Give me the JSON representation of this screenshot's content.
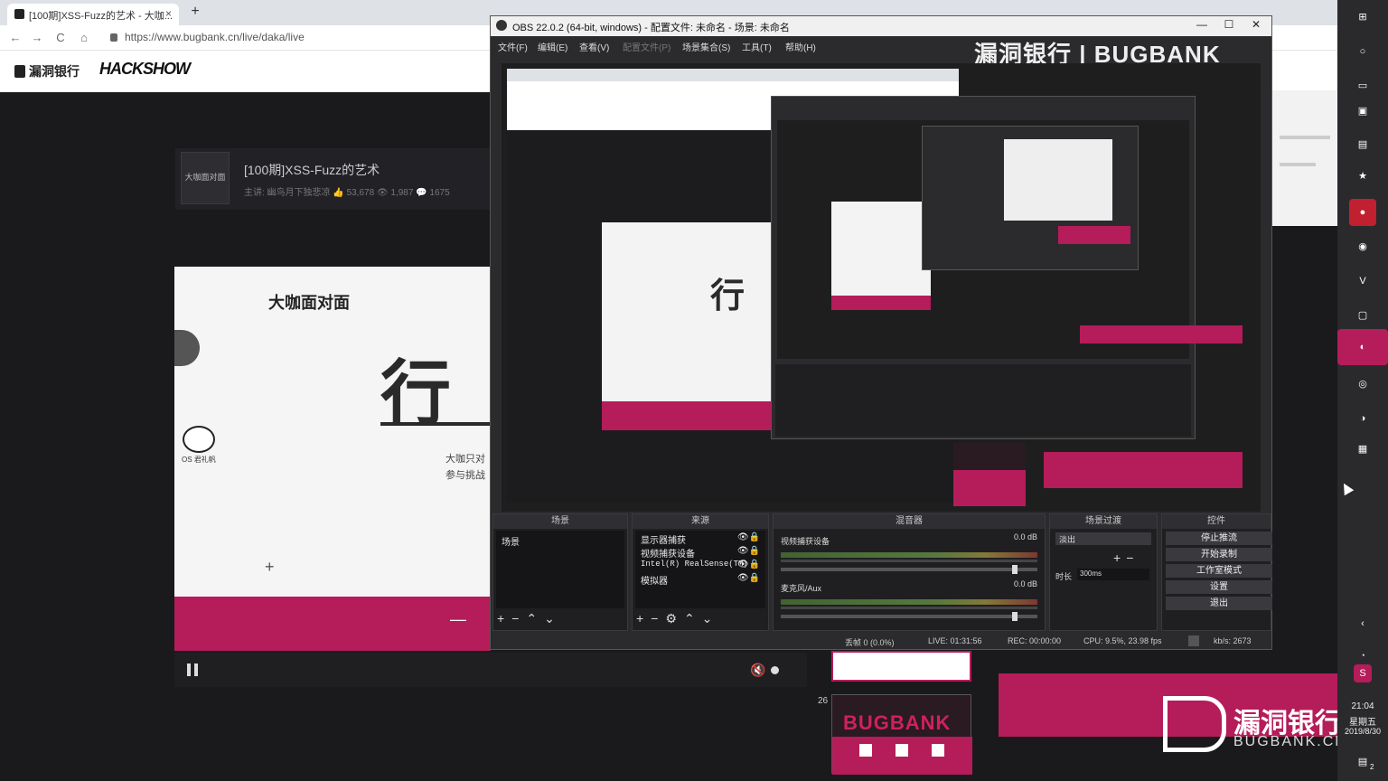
{
  "browser": {
    "tab_title": "[100期]XSS-Fuzz的艺术 - 大咖...",
    "tab_close": "×",
    "new_tab": "+",
    "url": "https://www.bugbank.cn/live/daka/live",
    "nav": {
      "back": "←",
      "forward": "→",
      "reload": "C",
      "home": "⌂"
    }
  },
  "site": {
    "logo_text": "漏洞银行",
    "logo2_text": "HACKSHOW"
  },
  "live": {
    "avatar_text": "大咖面对面",
    "title": "[100期]XSS-Fuzz的艺术",
    "subtitle": "主讲:  幽鸟月下独悲凉      👍 53,678   👁 1,987   💬 1675"
  },
  "player": {
    "title": "大咖面对面",
    "big_char": "行",
    "side_line1": "大咖只对",
    "side_line2": "参与挑战",
    "panda_label": "OS 君礼帆",
    "plus": "+",
    "minus": "—"
  },
  "obs": {
    "title": "OBS 22.0.2 (64-bit, windows) - 配置文件: 未命名 - 场景: 未命名",
    "window_buttons": {
      "minimize": "—",
      "maximize": "☐",
      "close": "✕"
    },
    "menu": [
      {
        "label": "文件(F)",
        "disabled": false
      },
      {
        "label": "编辑(E)",
        "disabled": false
      },
      {
        "label": "查看(V)",
        "disabled": false
      },
      {
        "label": "配置文件(P)",
        "disabled": true
      },
      {
        "label": "场景集合(S)",
        "disabled": false
      },
      {
        "label": "工具(T)",
        "disabled": false
      },
      {
        "label": "帮助(H)",
        "disabled": false
      }
    ],
    "banner": "漏洞银行 | BUGBANK",
    "docks": {
      "scenes": {
        "title": "场景",
        "items": [
          "场景"
        ]
      },
      "sources": {
        "title": "来源",
        "items": [
          "显示器捕获",
          "视频捕获设备",
          "Intel(R) RealSense(TM)",
          "模拟器"
        ]
      },
      "mixer": {
        "title": "混音器",
        "channels": [
          {
            "name": "视频捕获设备",
            "db": "0.0 dB"
          },
          {
            "name": "麦克风/Aux",
            "db": "0.0 dB"
          }
        ]
      },
      "transitions": {
        "title": "场景过渡",
        "selected": "淡出",
        "duration_label": "时长",
        "duration_value": "300ms"
      },
      "controls": {
        "title": "控件",
        "buttons": [
          "停止推流",
          "开始录制",
          "工作室模式",
          "设置",
          "退出"
        ]
      }
    },
    "status": {
      "dropped": "丢帧 0 (0.0%)",
      "live": "LIVE: 01:31:56",
      "rec": "REC: 00:00:00",
      "cpu": "CPU: 9.5%, 23.98 fps",
      "kbps": "kb/s: 2673"
    }
  },
  "bottom_brand": {
    "name": "漏洞银行",
    "domain": "BUGBANK.CN",
    "thumb_number": "26",
    "thumb_text": "BUGBANK"
  },
  "taskbar": {
    "time": "21:04",
    "weekday": "星期五",
    "date": "2019/8/30",
    "notify_count": "2"
  },
  "colors": {
    "accent": "#b51c5a",
    "obs_bg": "#2b2b2e",
    "dock_bg": "#1f1f21"
  }
}
